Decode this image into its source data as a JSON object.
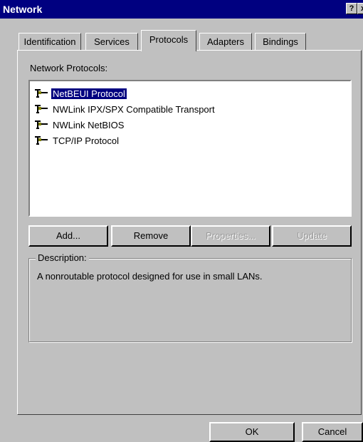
{
  "window": {
    "title": "Network",
    "help_label": "?",
    "close_label": "x"
  },
  "tabs": [
    {
      "label": "Identification"
    },
    {
      "label": "Services"
    },
    {
      "label": "Protocols"
    },
    {
      "label": "Adapters"
    },
    {
      "label": "Bindings"
    }
  ],
  "protocols": {
    "label": "Network Protocols:",
    "items": [
      {
        "label": "NetBEUI Protocol",
        "selected": true
      },
      {
        "label": "NWLink IPX/SPX Compatible Transport",
        "selected": false
      },
      {
        "label": "NWLink NetBIOS",
        "selected": false
      },
      {
        "label": "TCP/IP Protocol",
        "selected": false
      }
    ]
  },
  "buttons": {
    "add": "Add...",
    "remove": "Remove",
    "properties": "Properties...",
    "update": "Update"
  },
  "description": {
    "legend": "Description:",
    "text": "A nonroutable protocol designed for use in small LANs."
  },
  "footer": {
    "ok": "OK",
    "cancel": "Cancel"
  },
  "icons": {
    "protocol": "network-protocol-icon"
  }
}
